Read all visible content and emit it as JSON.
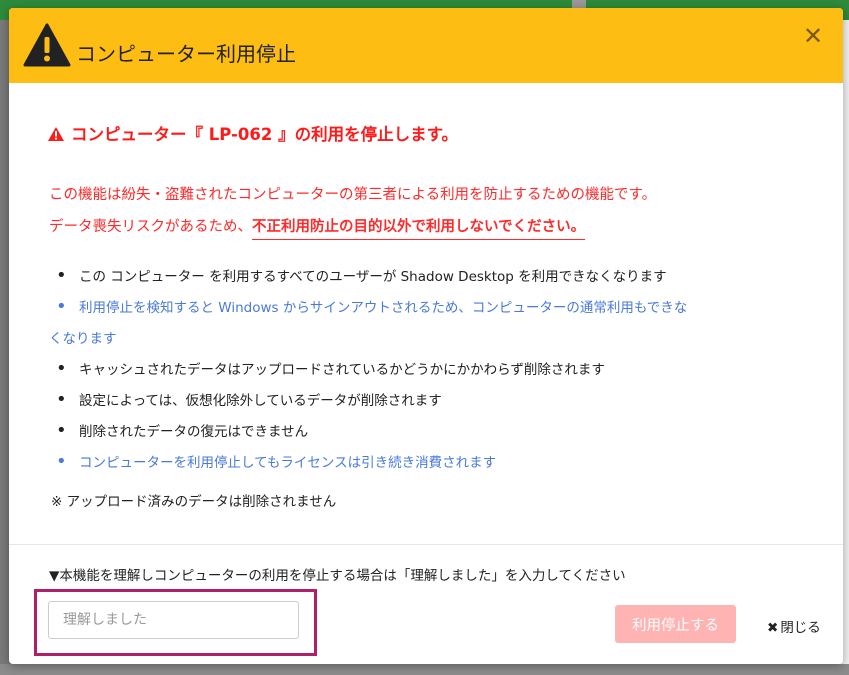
{
  "dialog": {
    "title": "コンピューター利用停止",
    "close_symbol": "✕",
    "warning_heading": "コンピューター『 LP-062 』の利用を停止します。",
    "description_line1": "この機能は紛失・盗難されたコンピューターの第三者による利用を防止するための機能です。",
    "description_line2_prefix": "データ喪失リスクがあるため、",
    "description_line2_emphasis": "不正利用防止の目的以外で利用しないでください。",
    "bullets": [
      {
        "text": "この コンピューター を利用するすべてのユーザーが Shadow Desktop を利用できなくなります",
        "color": "#222222"
      },
      {
        "text": "利用停止を検知すると Windows からサインアウトされるため、コンピューターの通常利用もできな",
        "continuation": "くなります",
        "color": "#4a7ad9"
      },
      {
        "text": "キャッシュされたデータはアップロードされているかどうかにかかわらず削除されます",
        "color": "#222222"
      },
      {
        "text": "設定によっては、仮想化除外しているデータが削除されます",
        "color": "#222222"
      },
      {
        "text": "削除されたデータの復元はできません",
        "color": "#222222"
      },
      {
        "text": "コンピューターを利用停止してもライセンスは引き続き消費されます",
        "color": "#4a7ad9"
      }
    ],
    "note": "※ アップロード済みのデータは削除されません",
    "instruction": "▼本機能を理解しコンピューターの利用を停止する場合は「理解しました」を入力してください",
    "input": {
      "value": "",
      "placeholder": "理解しました"
    },
    "stop_button_label": "利用停止する",
    "close_label": "閉じる",
    "close_label_icon": "✖"
  },
  "colors": {
    "header": "#fdbd13",
    "warning": "#ff1a1a",
    "link_blue": "#4a7ad9",
    "disabled_button": "#ffb3b3",
    "highlight": "#b0206a"
  },
  "icons": {
    "header": "warning-triangle-icon",
    "heading": "warning-triangle-icon",
    "close": "close-icon"
  }
}
